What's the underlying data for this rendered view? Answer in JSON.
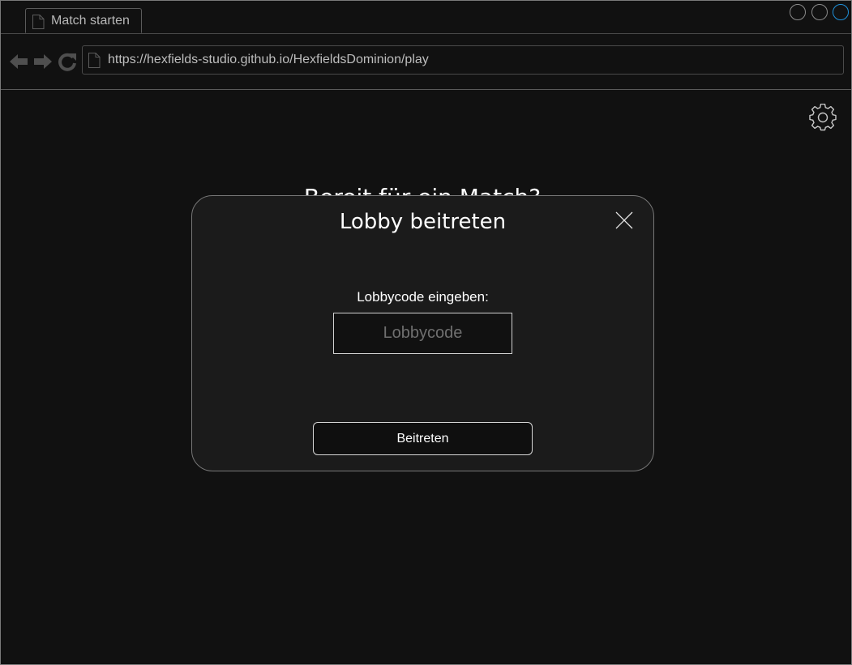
{
  "browser": {
    "tab_title": "Match starten",
    "tab_icon": "page-icon",
    "url": "https://hexfields-studio.github.io/HexfieldsDominion/play",
    "nav_icons": [
      "back-arrow-icon",
      "forward-arrow-icon",
      "reload-icon"
    ],
    "window_controls": [
      "minimize",
      "maximize",
      "close"
    ],
    "accent_color": "#1e8fd8"
  },
  "page": {
    "settings_icon": "gear-icon",
    "heading": "Bereit für ein Match?"
  },
  "modal": {
    "title": "Lobby beitreten",
    "close_icon": "close-icon",
    "field_label": "Lobbycode eingeben:",
    "input_value": "",
    "input_placeholder": "Lobbycode",
    "submit_label": "Beitreten"
  }
}
